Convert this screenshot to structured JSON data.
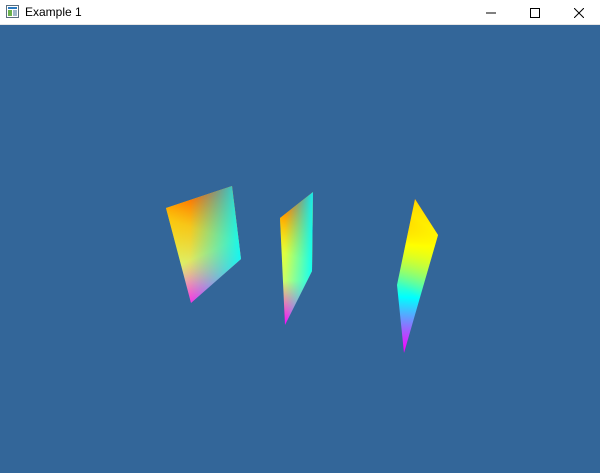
{
  "window": {
    "title": "Example 1",
    "background_color": "#336699",
    "icons": {
      "app": "app-window-icon",
      "minimize": "minimize-icon",
      "maximize": "maximize-icon",
      "close": "close-icon"
    }
  },
  "scene": {
    "object_count": 3,
    "vertex_colors": [
      "#ff0000",
      "#ffff00",
      "#00ffff",
      "#ff00ff"
    ]
  }
}
